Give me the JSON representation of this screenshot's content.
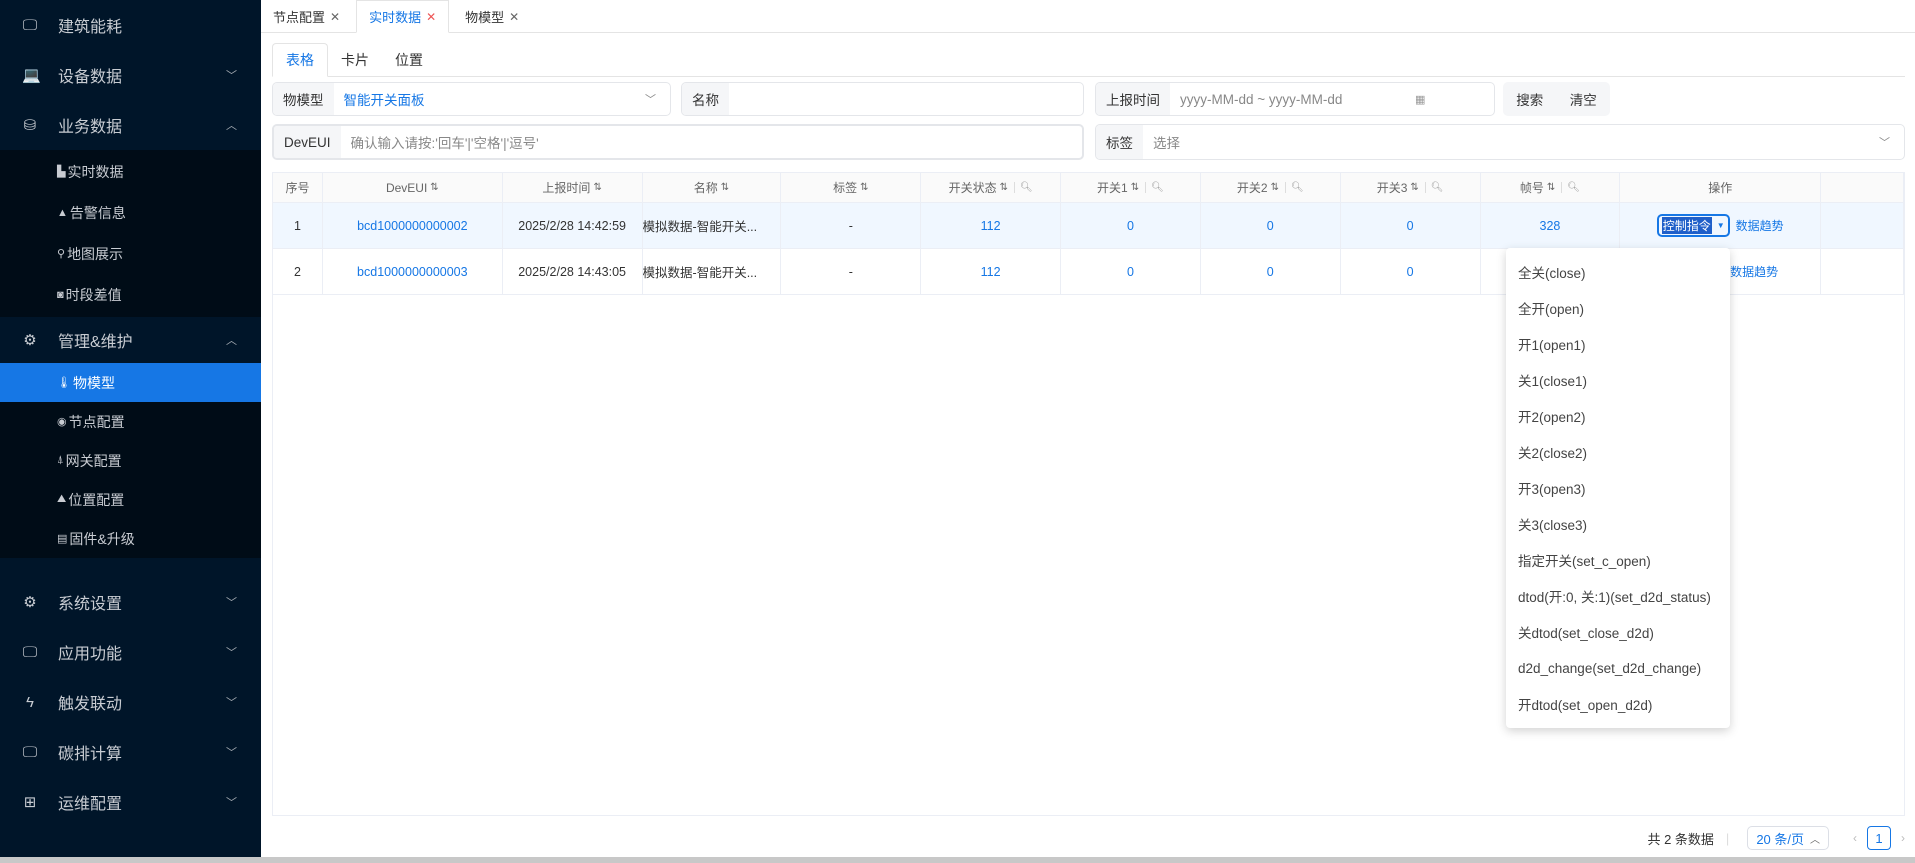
{
  "sidebar": {
    "top": [
      {
        "label": "建筑能耗",
        "icon": "monitor-icon",
        "arrow": ""
      },
      {
        "label": "设备数据",
        "icon": "laptop-icon",
        "arrow": "﹀"
      },
      {
        "label": "业务数据",
        "icon": "database-icon",
        "arrow": "︿"
      }
    ],
    "biz_sub": [
      {
        "label": "实时数据",
        "icon": "document-icon"
      },
      {
        "label": "告警信息",
        "icon": "warning-icon"
      },
      {
        "label": "地图展示",
        "icon": "map-pin-icon"
      },
      {
        "label": "时段差值",
        "icon": "camera-icon"
      }
    ],
    "mgmt": {
      "label": "管理&维护",
      "icon": "gears-icon",
      "arrow": "︿"
    },
    "mgmt_sub": [
      {
        "label": "物模型",
        "icon": "thermometer-icon"
      },
      {
        "label": "节点配置",
        "icon": "broadcast-icon"
      },
      {
        "label": "网关配置",
        "icon": "gateway-icon"
      },
      {
        "label": "位置配置",
        "icon": "location-map-icon"
      },
      {
        "label": "固件&升级",
        "icon": "file-icon"
      }
    ],
    "bottom": [
      {
        "label": "系统设置",
        "icon": "gear-icon"
      },
      {
        "label": "应用功能",
        "icon": "monitor-icon"
      },
      {
        "label": "触发联动",
        "icon": "bolt-icon"
      },
      {
        "label": "碳排计算",
        "icon": "monitor-icon"
      },
      {
        "label": "运维配置",
        "icon": "grid-icon"
      }
    ]
  },
  "page_tabs": [
    {
      "label": "节点配置"
    },
    {
      "label": "实时数据"
    },
    {
      "label": "物模型"
    }
  ],
  "sub_tabs": [
    {
      "label": "表格"
    },
    {
      "label": "卡片"
    },
    {
      "label": "位置"
    }
  ],
  "filters": {
    "model_label": "物模型",
    "model_value": "智能开关面板",
    "name_label": "名称",
    "name_value": "",
    "time_label": "上报时间",
    "time_placeholder": "yyyy-MM-dd ~ yyyy-MM-dd",
    "search": "搜索",
    "clear": "清空",
    "deveui_label": "DevEUI",
    "deveui_placeholder": "确认输入请按:'回车'|'空格'|'逗号'",
    "tag_label": "标签",
    "tag_placeholder": "选择"
  },
  "table": {
    "headers": [
      "序号",
      "DevEUI",
      "上报时间",
      "名称",
      "标签",
      "开关状态",
      "开关1",
      "开关2",
      "开关3",
      "帧号",
      "操作"
    ],
    "rows": [
      {
        "idx": "1",
        "deveui": "bcd1000000000002",
        "time": "2025/2/28 14:42:59",
        "name": "模拟数据-智能开关...",
        "tag": "-",
        "status": "112",
        "s1": "0",
        "s2": "0",
        "s3": "0",
        "frame": "328"
      },
      {
        "idx": "2",
        "deveui": "bcd1000000000003",
        "time": "2025/2/28 14:43:05",
        "name": "模拟数据-智能开关...",
        "tag": "-",
        "status": "112",
        "s1": "0",
        "s2": "0",
        "s3": "0",
        "frame": ""
      }
    ],
    "control_label": "控制指令",
    "trend_label": "数据趋势"
  },
  "dropdown": [
    "全关(close)",
    "全开(open)",
    "开1(open1)",
    "关1(close1)",
    "开2(open2)",
    "关2(close2)",
    "开3(open3)",
    "关3(close3)",
    "指定开关(set_c_open)",
    "dtod(开:0, 关:1)(set_d2d_status)",
    "关dtod(set_close_d2d)",
    "d2d_change(set_d2d_change)",
    "开dtod(set_open_d2d)"
  ],
  "pager": {
    "total": "共 2 条数据",
    "size": "20 条/页",
    "current": "1"
  }
}
